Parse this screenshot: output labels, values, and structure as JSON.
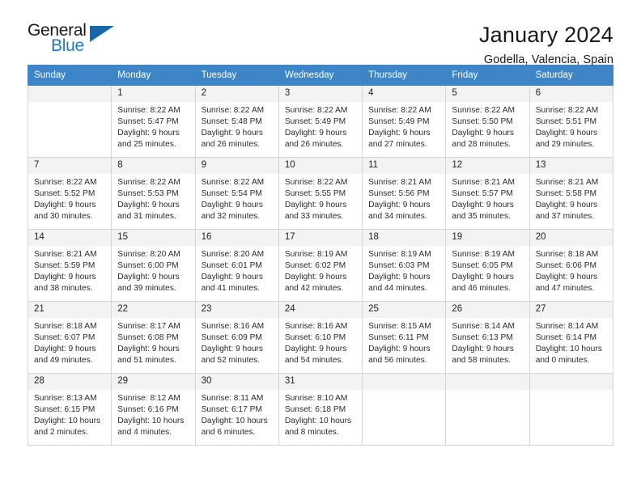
{
  "brand": {
    "name_top": "General",
    "name_bottom": "Blue",
    "accent_color": "#1f7bc1",
    "triangle_color": "#1668ad"
  },
  "header": {
    "title": "January 2024",
    "subtitle": "Godella, Valencia, Spain"
  },
  "calendar": {
    "header_bg": "#3d85c6",
    "header_text_color": "#ffffff",
    "weekdays": [
      "Sunday",
      "Monday",
      "Tuesday",
      "Wednesday",
      "Thursday",
      "Friday",
      "Saturday"
    ],
    "labels": {
      "sunrise": "Sunrise:",
      "sunset": "Sunset:",
      "daylight": "Daylight:"
    },
    "weeks": [
      [
        {
          "day": "",
          "sunrise": "",
          "sunset": "",
          "daylight_1": "",
          "daylight_2": ""
        },
        {
          "day": "1",
          "sunrise": "Sunrise: 8:22 AM",
          "sunset": "Sunset: 5:47 PM",
          "daylight_1": "Daylight: 9 hours",
          "daylight_2": "and 25 minutes."
        },
        {
          "day": "2",
          "sunrise": "Sunrise: 8:22 AM",
          "sunset": "Sunset: 5:48 PM",
          "daylight_1": "Daylight: 9 hours",
          "daylight_2": "and 26 minutes."
        },
        {
          "day": "3",
          "sunrise": "Sunrise: 8:22 AM",
          "sunset": "Sunset: 5:49 PM",
          "daylight_1": "Daylight: 9 hours",
          "daylight_2": "and 26 minutes."
        },
        {
          "day": "4",
          "sunrise": "Sunrise: 8:22 AM",
          "sunset": "Sunset: 5:49 PM",
          "daylight_1": "Daylight: 9 hours",
          "daylight_2": "and 27 minutes."
        },
        {
          "day": "5",
          "sunrise": "Sunrise: 8:22 AM",
          "sunset": "Sunset: 5:50 PM",
          "daylight_1": "Daylight: 9 hours",
          "daylight_2": "and 28 minutes."
        },
        {
          "day": "6",
          "sunrise": "Sunrise: 8:22 AM",
          "sunset": "Sunset: 5:51 PM",
          "daylight_1": "Daylight: 9 hours",
          "daylight_2": "and 29 minutes."
        }
      ],
      [
        {
          "day": "7",
          "sunrise": "Sunrise: 8:22 AM",
          "sunset": "Sunset: 5:52 PM",
          "daylight_1": "Daylight: 9 hours",
          "daylight_2": "and 30 minutes."
        },
        {
          "day": "8",
          "sunrise": "Sunrise: 8:22 AM",
          "sunset": "Sunset: 5:53 PM",
          "daylight_1": "Daylight: 9 hours",
          "daylight_2": "and 31 minutes."
        },
        {
          "day": "9",
          "sunrise": "Sunrise: 8:22 AM",
          "sunset": "Sunset: 5:54 PM",
          "daylight_1": "Daylight: 9 hours",
          "daylight_2": "and 32 minutes."
        },
        {
          "day": "10",
          "sunrise": "Sunrise: 8:22 AM",
          "sunset": "Sunset: 5:55 PM",
          "daylight_1": "Daylight: 9 hours",
          "daylight_2": "and 33 minutes."
        },
        {
          "day": "11",
          "sunrise": "Sunrise: 8:21 AM",
          "sunset": "Sunset: 5:56 PM",
          "daylight_1": "Daylight: 9 hours",
          "daylight_2": "and 34 minutes."
        },
        {
          "day": "12",
          "sunrise": "Sunrise: 8:21 AM",
          "sunset": "Sunset: 5:57 PM",
          "daylight_1": "Daylight: 9 hours",
          "daylight_2": "and 35 minutes."
        },
        {
          "day": "13",
          "sunrise": "Sunrise: 8:21 AM",
          "sunset": "Sunset: 5:58 PM",
          "daylight_1": "Daylight: 9 hours",
          "daylight_2": "and 37 minutes."
        }
      ],
      [
        {
          "day": "14",
          "sunrise": "Sunrise: 8:21 AM",
          "sunset": "Sunset: 5:59 PM",
          "daylight_1": "Daylight: 9 hours",
          "daylight_2": "and 38 minutes."
        },
        {
          "day": "15",
          "sunrise": "Sunrise: 8:20 AM",
          "sunset": "Sunset: 6:00 PM",
          "daylight_1": "Daylight: 9 hours",
          "daylight_2": "and 39 minutes."
        },
        {
          "day": "16",
          "sunrise": "Sunrise: 8:20 AM",
          "sunset": "Sunset: 6:01 PM",
          "daylight_1": "Daylight: 9 hours",
          "daylight_2": "and 41 minutes."
        },
        {
          "day": "17",
          "sunrise": "Sunrise: 8:19 AM",
          "sunset": "Sunset: 6:02 PM",
          "daylight_1": "Daylight: 9 hours",
          "daylight_2": "and 42 minutes."
        },
        {
          "day": "18",
          "sunrise": "Sunrise: 8:19 AM",
          "sunset": "Sunset: 6:03 PM",
          "daylight_1": "Daylight: 9 hours",
          "daylight_2": "and 44 minutes."
        },
        {
          "day": "19",
          "sunrise": "Sunrise: 8:19 AM",
          "sunset": "Sunset: 6:05 PM",
          "daylight_1": "Daylight: 9 hours",
          "daylight_2": "and 46 minutes."
        },
        {
          "day": "20",
          "sunrise": "Sunrise: 8:18 AM",
          "sunset": "Sunset: 6:06 PM",
          "daylight_1": "Daylight: 9 hours",
          "daylight_2": "and 47 minutes."
        }
      ],
      [
        {
          "day": "21",
          "sunrise": "Sunrise: 8:18 AM",
          "sunset": "Sunset: 6:07 PM",
          "daylight_1": "Daylight: 9 hours",
          "daylight_2": "and 49 minutes."
        },
        {
          "day": "22",
          "sunrise": "Sunrise: 8:17 AM",
          "sunset": "Sunset: 6:08 PM",
          "daylight_1": "Daylight: 9 hours",
          "daylight_2": "and 51 minutes."
        },
        {
          "day": "23",
          "sunrise": "Sunrise: 8:16 AM",
          "sunset": "Sunset: 6:09 PM",
          "daylight_1": "Daylight: 9 hours",
          "daylight_2": "and 52 minutes."
        },
        {
          "day": "24",
          "sunrise": "Sunrise: 8:16 AM",
          "sunset": "Sunset: 6:10 PM",
          "daylight_1": "Daylight: 9 hours",
          "daylight_2": "and 54 minutes."
        },
        {
          "day": "25",
          "sunrise": "Sunrise: 8:15 AM",
          "sunset": "Sunset: 6:11 PM",
          "daylight_1": "Daylight: 9 hours",
          "daylight_2": "and 56 minutes."
        },
        {
          "day": "26",
          "sunrise": "Sunrise: 8:14 AM",
          "sunset": "Sunset: 6:13 PM",
          "daylight_1": "Daylight: 9 hours",
          "daylight_2": "and 58 minutes."
        },
        {
          "day": "27",
          "sunrise": "Sunrise: 8:14 AM",
          "sunset": "Sunset: 6:14 PM",
          "daylight_1": "Daylight: 10 hours",
          "daylight_2": "and 0 minutes."
        }
      ],
      [
        {
          "day": "28",
          "sunrise": "Sunrise: 8:13 AM",
          "sunset": "Sunset: 6:15 PM",
          "daylight_1": "Daylight: 10 hours",
          "daylight_2": "and 2 minutes."
        },
        {
          "day": "29",
          "sunrise": "Sunrise: 8:12 AM",
          "sunset": "Sunset: 6:16 PM",
          "daylight_1": "Daylight: 10 hours",
          "daylight_2": "and 4 minutes."
        },
        {
          "day": "30",
          "sunrise": "Sunrise: 8:11 AM",
          "sunset": "Sunset: 6:17 PM",
          "daylight_1": "Daylight: 10 hours",
          "daylight_2": "and 6 minutes."
        },
        {
          "day": "31",
          "sunrise": "Sunrise: 8:10 AM",
          "sunset": "Sunset: 6:18 PM",
          "daylight_1": "Daylight: 10 hours",
          "daylight_2": "and 8 minutes."
        },
        {
          "day": "",
          "sunrise": "",
          "sunset": "",
          "daylight_1": "",
          "daylight_2": ""
        },
        {
          "day": "",
          "sunrise": "",
          "sunset": "",
          "daylight_1": "",
          "daylight_2": ""
        },
        {
          "day": "",
          "sunrise": "",
          "sunset": "",
          "daylight_1": "",
          "daylight_2": ""
        }
      ]
    ]
  }
}
